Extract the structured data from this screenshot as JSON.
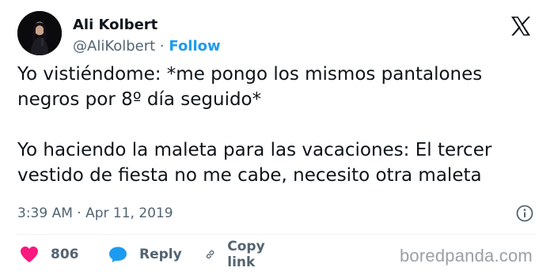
{
  "author": {
    "display_name": "Ali Kolbert",
    "handle": "@AliKolbert",
    "separator": " · ",
    "follow_label": "Follow"
  },
  "tweet": {
    "lines": [
      "Yo vistiéndome: *me pongo los mismos pantalones",
      "negros por 8º día seguido*",
      "Yo haciendo la maleta para las vacaciones: El tercer",
      "vestido de fiesta no me cabe, necesito otra maleta"
    ],
    "time": "3:39 AM",
    "date_separator": " · ",
    "date": "Apr 11, 2019"
  },
  "actions": {
    "likes": "806",
    "reply_label": "Reply",
    "copy_link_label": "Copy link"
  },
  "watermark": "boredpanda.com",
  "colors": {
    "accent": "#1d9bf0",
    "like": "#f91880",
    "text": "#0f1419",
    "muted": "#536471"
  },
  "icons": [
    "x-logo-icon",
    "info-icon",
    "heart-icon",
    "reply-bubble-icon",
    "link-icon"
  ]
}
